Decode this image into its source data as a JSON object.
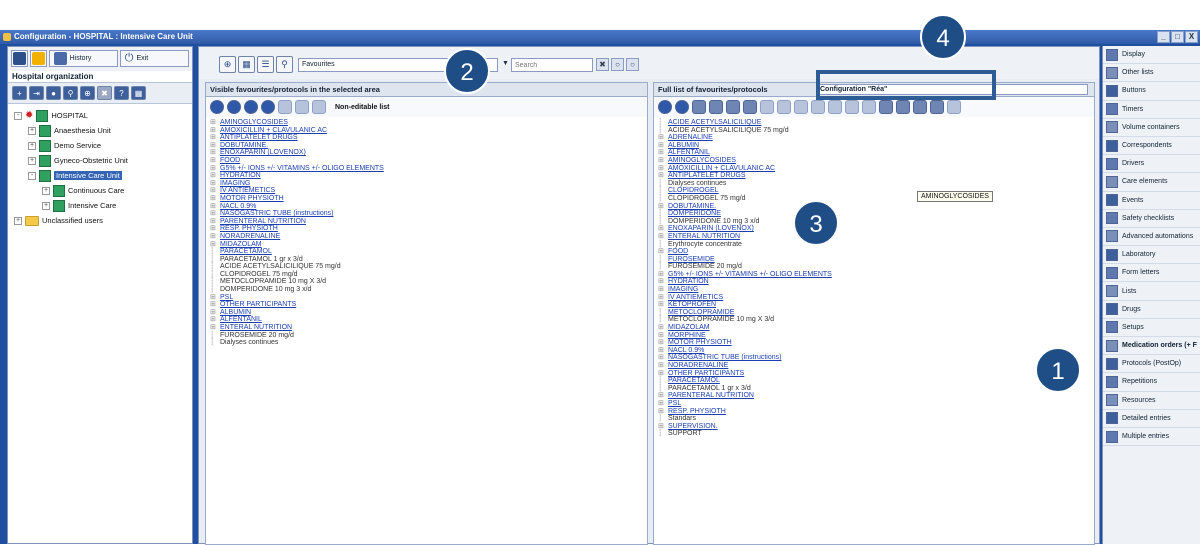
{
  "window": {
    "title": "Configuration - HOSPITAL : Intensive Care Unit",
    "buttons": [
      "_",
      "□",
      "X"
    ]
  },
  "left": {
    "history_label": "History",
    "exit_label": "Exit",
    "section_label": "Hospital organization",
    "tree": [
      {
        "label": "HOSPITAL",
        "level": 0,
        "expander": "-",
        "kind": "hospital"
      },
      {
        "label": "Anaesthesia Unit",
        "level": 1,
        "expander": "+",
        "kind": "unit"
      },
      {
        "label": "Demo Service",
        "level": 1,
        "expander": "+",
        "kind": "unit"
      },
      {
        "label": "Gyneco-Obstetric Unit",
        "level": 1,
        "expander": "+",
        "kind": "unit"
      },
      {
        "label": "Intensive Care Unit",
        "level": 1,
        "expander": "-",
        "kind": "unit",
        "selected": true
      },
      {
        "label": "Continuous Care",
        "level": 2,
        "expander": "+",
        "kind": "unit"
      },
      {
        "label": "Intensive Care",
        "level": 2,
        "expander": "+",
        "kind": "unit"
      },
      {
        "label": "Unclassified users",
        "level": 0,
        "expander": "+",
        "kind": "folder"
      }
    ]
  },
  "toolbar": {
    "favourites_value": "Favourites",
    "search_placeholder": "Search"
  },
  "visible_panel": {
    "title": "Visible favourites/protocols in the selected area",
    "noneditable": "Non-editable list",
    "items": [
      {
        "t": "AMINOGLYCOSIDES",
        "k": "g"
      },
      {
        "t": "AMOXICILLIN + CLAVULANIC AC",
        "k": "g"
      },
      {
        "t": "ANTIPLATELET DRUGS",
        "k": "g"
      },
      {
        "t": "DOBUTAMINE.",
        "k": "g"
      },
      {
        "t": "ENOXAPARIN (LOVENOX)",
        "k": "g"
      },
      {
        "t": "FOOD",
        "k": "g"
      },
      {
        "t": "G5% +/- IONS +/- VITAMINS +/- OLIGO ELEMENTS",
        "k": "g"
      },
      {
        "t": "HYDRATION",
        "k": "g"
      },
      {
        "t": "IMAGING",
        "k": "g"
      },
      {
        "t": "IV ANTIEMETICS",
        "k": "g"
      },
      {
        "t": "MOTOR PHYSIOTH",
        "k": "g"
      },
      {
        "t": "NACL 0.9%",
        "k": "g"
      },
      {
        "t": "NASOGASTRIC TUBE (instructions)",
        "k": "g"
      },
      {
        "t": "PARENTERAL NUTRITION",
        "k": "g"
      },
      {
        "t": "RESP. PHYSIOTH",
        "k": "g"
      },
      {
        "t": "NORADRENALINE",
        "k": "g"
      },
      {
        "t": "MIDAZOLAM",
        "k": "g"
      },
      {
        "t": "PARACETAMOL",
        "k": "l"
      },
      {
        "t": "PARACETAMOL  1 gr x 3/d",
        "k": "p"
      },
      {
        "t": "ACIDE ACETYLSALICILIQUE 75 mg/d",
        "k": "p"
      },
      {
        "t": "CLOPIDROGEL 75 mg/d",
        "k": "p"
      },
      {
        "t": "METOCLOPRAMIDE 10 mg X 3/d",
        "k": "p"
      },
      {
        "t": "DOMPERIDONE 10 mg 3 x/d",
        "k": "p"
      },
      {
        "t": "PSL",
        "k": "g"
      },
      {
        "t": "OTHER PARTICIPANTS",
        "k": "g"
      },
      {
        "t": "ALBUMIN",
        "k": "g"
      },
      {
        "t": "ALFENTANIL",
        "k": "g"
      },
      {
        "t": "ENTERAL NUTRITION",
        "k": "g"
      },
      {
        "t": "FUROSEMIDE 20 mg/d",
        "k": "p"
      },
      {
        "t": "Dialyses continues",
        "k": "p"
      }
    ]
  },
  "full_panel": {
    "title": "Full list of favourites/protocols",
    "config_value": "Configuration \"Réa\"",
    "items": [
      {
        "t": "ACIDE ACETYLSALICILIQUE",
        "k": "l"
      },
      {
        "t": "ACIDE ACETYLSALICILIQUE 75 mg/d",
        "k": "p"
      },
      {
        "t": "ADRENALINE",
        "k": "g"
      },
      {
        "t": "ALBUMIN",
        "k": "g"
      },
      {
        "t": "ALFENTANIL",
        "k": "g"
      },
      {
        "t": "AMINOGLYCOSIDES",
        "k": "g"
      },
      {
        "t": "AMOXICILLIN + CLAVULANIC AC",
        "k": "g"
      },
      {
        "t": "ANTIPLATELET DRUGS",
        "k": "g"
      },
      {
        "t": "Dialyses continues",
        "k": "p"
      },
      {
        "t": "CLOPIDROGEL",
        "k": "l"
      },
      {
        "t": "CLOPIDROGEL 75 mg/d",
        "k": "p"
      },
      {
        "t": "DOBUTAMINE.",
        "k": "g"
      },
      {
        "t": "DOMPERIDONE",
        "k": "l"
      },
      {
        "t": "DOMPERIDONE 10 mg 3 x/d",
        "k": "p"
      },
      {
        "t": "ENOXAPARIN (LOVENOX)",
        "k": "g"
      },
      {
        "t": "ENTERAL NUTRITION",
        "k": "g"
      },
      {
        "t": "Erythrocyte concentrate",
        "k": "p"
      },
      {
        "t": "FOOD",
        "k": "g"
      },
      {
        "t": "FUROSEMIDE",
        "k": "l"
      },
      {
        "t": "FUROSEMIDE 20 mg/d",
        "k": "p"
      },
      {
        "t": "G5% +/- IONS +/- VITAMINS +/- OLIGO ELEMENTS",
        "k": "g"
      },
      {
        "t": "HYDRATION",
        "k": "g"
      },
      {
        "t": "IMAGING",
        "k": "g"
      },
      {
        "t": "IV ANTIEMETICS",
        "k": "g"
      },
      {
        "t": "KETOPROFEN",
        "k": "g"
      },
      {
        "t": "METOCLOPRAMIDE",
        "k": "l"
      },
      {
        "t": "METOCLOPRAMIDE 10 mg X 3/d",
        "k": "p"
      },
      {
        "t": "MIDAZOLAM",
        "k": "g"
      },
      {
        "t": "MORPHINE",
        "k": "g"
      },
      {
        "t": "MOTOR PHYSIOTH",
        "k": "g"
      },
      {
        "t": "NACL 0.9%",
        "k": "g"
      },
      {
        "t": "NASOGASTRIC TUBE (instructions)",
        "k": "g"
      },
      {
        "t": "NORADRENALINE",
        "k": "g"
      },
      {
        "t": "OTHER PARTICIPANTS",
        "k": "g"
      },
      {
        "t": "PARACETAMOL",
        "k": "l"
      },
      {
        "t": "PARACETAMOL  1 gr x 3/d",
        "k": "p"
      },
      {
        "t": "PARENTERAL NUTRITION",
        "k": "g"
      },
      {
        "t": "PSL",
        "k": "g"
      },
      {
        "t": "RESP. PHYSIOTH",
        "k": "g"
      },
      {
        "t": "Standars",
        "k": "p"
      },
      {
        "t": "SUPERVISION.",
        "k": "g"
      },
      {
        "t": "SUPPORT",
        "k": "p"
      }
    ]
  },
  "tooltip": "AMINOGLYCOSIDES",
  "right_menu": [
    {
      "label": "Display"
    },
    {
      "label": "Other lists"
    },
    {
      "label": "Buttons"
    },
    {
      "label": "Timers"
    },
    {
      "label": "Volume containers"
    },
    {
      "label": "Correspondents"
    },
    {
      "label": "Drivers"
    },
    {
      "label": "Care elements"
    },
    {
      "label": "Events"
    },
    {
      "label": "Safety checklists"
    },
    {
      "label": "Advanced automations"
    },
    {
      "label": "Laboratory"
    },
    {
      "label": "Form letters"
    },
    {
      "label": "Lists"
    },
    {
      "label": "Drugs"
    },
    {
      "label": "Setups"
    },
    {
      "label": "Medication orders (+ F",
      "bold": true
    },
    {
      "label": "Protocols (PostOp)"
    },
    {
      "label": "Repetitions"
    },
    {
      "label": "Resources"
    },
    {
      "label": "Detailed entries"
    },
    {
      "label": "Multiple entries"
    }
  ],
  "callouts": [
    "1",
    "2",
    "3",
    "4"
  ],
  "colors": {
    "frame": "#1f4fa0",
    "callout": "#1f4e86",
    "link": "#1b3fb0"
  }
}
